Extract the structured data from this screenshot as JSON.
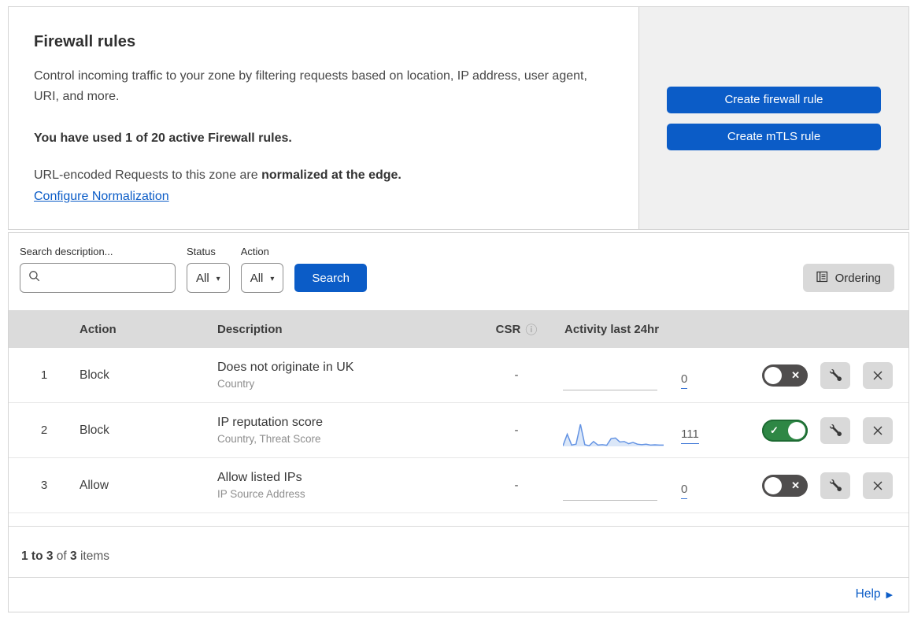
{
  "header": {
    "title": "Firewall rules",
    "description": "Control incoming traffic to your zone by filtering requests based on location, IP address, user agent, URI, and more.",
    "usage_notice": "You have used 1 of 20 active Firewall rules.",
    "normalization_prefix": "URL-encoded Requests to this zone are ",
    "normalization_bold": "normalized at the edge.",
    "normalization_link": "Configure Normalization",
    "buttons": {
      "create_firewall": "Create firewall rule",
      "create_mtls": "Create mTLS rule"
    }
  },
  "filters": {
    "search_label": "Search description...",
    "status_label": "Status",
    "status_value": "All",
    "action_label": "Action",
    "action_value": "All",
    "search_button": "Search",
    "ordering_button": "Ordering"
  },
  "table": {
    "columns": {
      "action": "Action",
      "description": "Description",
      "csr": "CSR",
      "activity": "Activity last 24hr"
    },
    "rows": [
      {
        "index": "1",
        "action": "Block",
        "description": "Does not originate in UK",
        "fields": "Country",
        "csr": "-",
        "activity_count": "0",
        "enabled": false,
        "sparkline": null
      },
      {
        "index": "2",
        "action": "Block",
        "description": "IP reputation score",
        "fields": "Country, Threat Score",
        "csr": "-",
        "activity_count": "111",
        "enabled": true,
        "sparkline": [
          2,
          55,
          6,
          10,
          100,
          8,
          3,
          22,
          6,
          8,
          5,
          35,
          38,
          20,
          22,
          12,
          18,
          10,
          8,
          10,
          6,
          7,
          6,
          6
        ]
      },
      {
        "index": "3",
        "action": "Allow",
        "description": "Allow listed IPs",
        "fields": "IP Source Address",
        "csr": "-",
        "activity_count": "0",
        "enabled": false,
        "sparkline": null
      }
    ]
  },
  "footer": {
    "pagination_range": "1 to 3",
    "pagination_of": " of ",
    "pagination_total": "3",
    "pagination_items": " items",
    "help_label": "Help"
  },
  "colors": {
    "primary_blue": "#0b5cc7",
    "link_blue": "#0b5cc7",
    "toggle_on_green": "#2e8745",
    "toggle_on_border": "#1e6b33",
    "toggle_off_gray": "#4f4d4d",
    "sparkline_blue": "#6292e3",
    "sparkline_fill": "#dbe7f8",
    "header_row_bg": "#dbdbdb",
    "panel_bg": "#f0f0f0",
    "control_btn_bg": "#d9d9d9",
    "border_gray": "#d4d4d4"
  }
}
